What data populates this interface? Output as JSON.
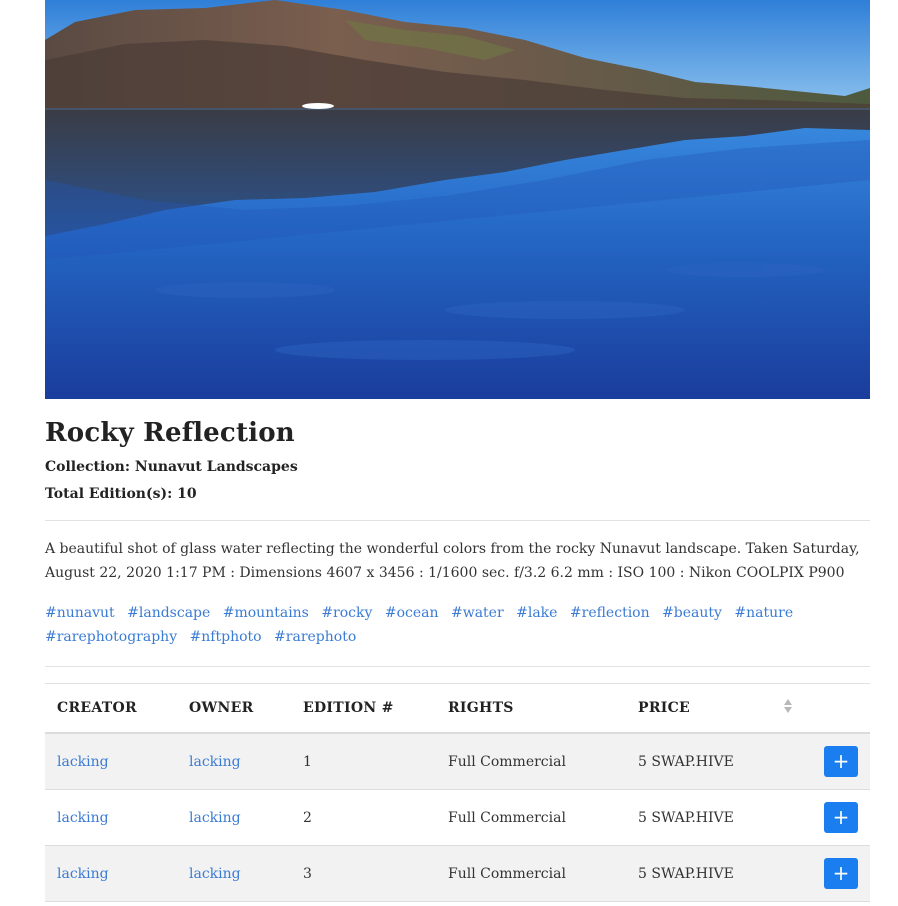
{
  "artwork": {
    "title": "Rocky Reflection",
    "collection": "Collection: Nunavut Landscapes",
    "editions": "Total Edition(s): 10",
    "description": "A beautiful shot of glass water reflecting the wonderful colors from the rocky Nunavut landscape. Taken Saturday, August 22, 2020 1:17 PM : Dimensions 4607 x 3456 : 1/1600 sec. f/3.2 6.2 mm : ISO 100 : Nikon COOLPIX P900",
    "tags": [
      "#nunavut",
      "#landscape",
      "#mountains",
      "#rocky",
      "#ocean",
      "#water",
      "#lake",
      "#reflection",
      "#beauty",
      "#nature",
      "#rarephotography",
      "#nftphoto",
      "#rarephoto"
    ]
  },
  "table": {
    "headers": {
      "creator": "CREATOR",
      "owner": "OWNER",
      "edition": "EDITION #",
      "rights": "RIGHTS",
      "price": "PRICE"
    },
    "sort_icon": "sort-icon",
    "rows": [
      {
        "creator": "lacking",
        "owner": "lacking",
        "edition": "1",
        "rights": "Full Commercial",
        "price": "5 SWAP.HIVE",
        "action": "+"
      },
      {
        "creator": "lacking",
        "owner": "lacking",
        "edition": "2",
        "rights": "Full Commercial",
        "price": "5 SWAP.HIVE",
        "action": "+"
      },
      {
        "creator": "lacking",
        "owner": "lacking",
        "edition": "3",
        "rights": "Full Commercial",
        "price": "5 SWAP.HIVE",
        "action": "+"
      }
    ]
  },
  "colors": {
    "link": "#3a7bd5",
    "button": "#1a7ef0"
  }
}
